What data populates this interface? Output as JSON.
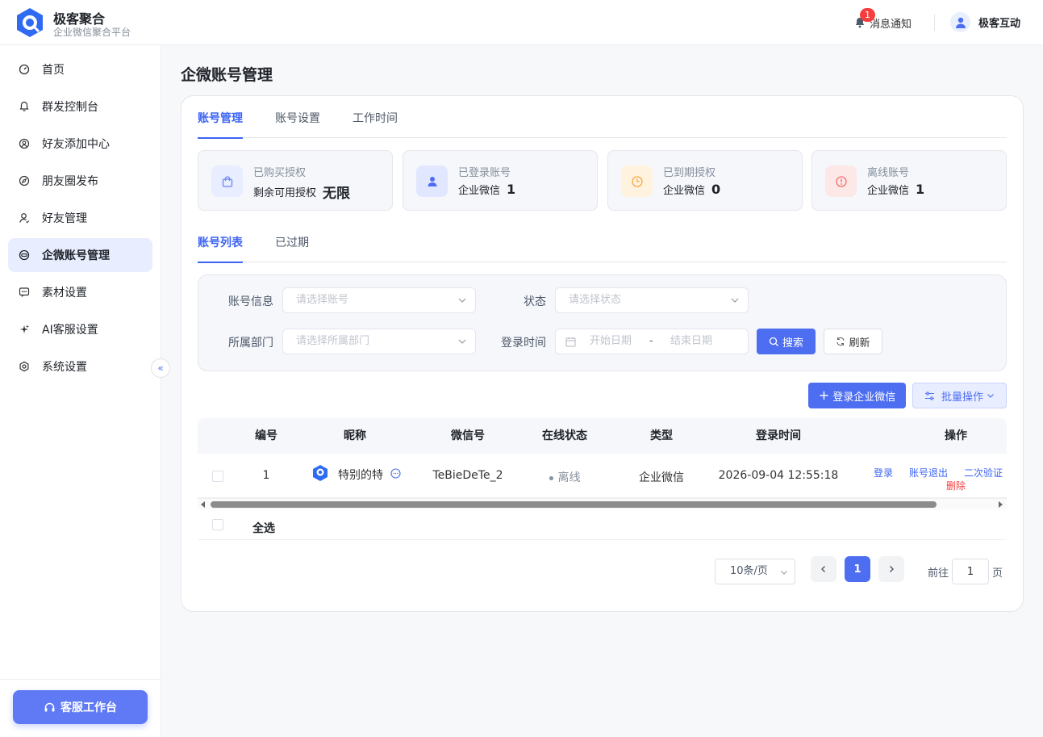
{
  "brand": {
    "title": "极客聚合",
    "subtitle": "企业微信聚合平台"
  },
  "header": {
    "notify_label": "消息通知",
    "notify_count": "1",
    "user_name": "极客互动"
  },
  "sidebar": {
    "items": [
      {
        "label": "首页",
        "icon": "dashboard-icon"
      },
      {
        "label": "群发控制台",
        "icon": "bell-icon"
      },
      {
        "label": "好友添加中心",
        "icon": "user-add-icon"
      },
      {
        "label": "朋友圈发布",
        "icon": "compass-icon"
      },
      {
        "label": "好友管理",
        "icon": "user-icon"
      },
      {
        "label": "企微账号管理",
        "icon": "account-icon",
        "active": true
      },
      {
        "label": "素材设置",
        "icon": "message-icon"
      },
      {
        "label": "AI客服设置",
        "icon": "sparkle-icon"
      },
      {
        "label": "系统设置",
        "icon": "gear-icon"
      }
    ],
    "service_button": "客服工作台"
  },
  "page": {
    "title": "企微账号管理"
  },
  "tabs": [
    "账号管理",
    "账号设置",
    "工作时间"
  ],
  "stats": [
    {
      "label": "已购买授权",
      "sub": "剩余可用授权",
      "value": "无限",
      "color": "#4e6ef2",
      "bg": "#e8edff"
    },
    {
      "label": "已登录账号",
      "sub": "企业微信",
      "value": "1",
      "color": "#4e6ef2",
      "bg": "#e0e7ff"
    },
    {
      "label": "已到期授权",
      "sub": "企业微信",
      "value": "0",
      "color": "#f7a63b",
      "bg": "#fff3e0"
    },
    {
      "label": "离线账号",
      "sub": "企业微信",
      "value": "1",
      "color": "#f56c6c",
      "bg": "#fde8e8"
    }
  ],
  "subtabs": [
    "账号列表",
    "已过期"
  ],
  "filters": {
    "account_label": "账号信息",
    "account_placeholder": "请选择账号",
    "status_label": "状态",
    "status_placeholder": "请选择状态",
    "dept_label": "所属部门",
    "dept_placeholder": "请选择所属部门",
    "time_label": "登录时间",
    "start_placeholder": "开始日期",
    "sep": "-",
    "end_placeholder": "结束日期",
    "search_btn": "搜索",
    "refresh_btn": "刷新"
  },
  "actions": {
    "login_btn": "登录企业微信",
    "batch_btn": "批量操作"
  },
  "table": {
    "columns": [
      "编号",
      "昵称",
      "微信号",
      "在线状态",
      "类型",
      "登录时间",
      "操作"
    ],
    "rows": [
      {
        "id": "1",
        "nickname": "特别的特",
        "wechat": "TeBieDeTe_2",
        "status": "离线",
        "type": "企业微信",
        "login_time": "2026-09-04 12:55:18",
        "ops": [
          "登录",
          "账号退出",
          "二次验证",
          "删除"
        ]
      }
    ],
    "select_all": "全选"
  },
  "pagination": {
    "page_size": "10条/页",
    "current": "1",
    "goto_label": "前往",
    "goto_value": "1",
    "page_unit": "页"
  }
}
